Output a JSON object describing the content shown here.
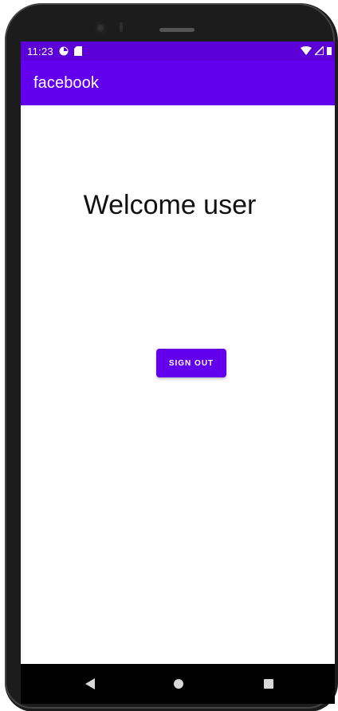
{
  "status_bar": {
    "time": "11:23",
    "icons": [
      "data-saver-icon",
      "sd-card-icon"
    ],
    "right_icons": [
      "wifi-icon",
      "signal-icon",
      "battery-icon"
    ]
  },
  "app_bar": {
    "title": "facebook"
  },
  "main": {
    "welcome_text": "Welcome user",
    "sign_out_label": "SIGN OUT"
  },
  "nav_bar": {
    "icons": [
      "back-icon",
      "home-icon",
      "recents-icon"
    ]
  },
  "colors": {
    "primary": "#6200ee",
    "status_bar": "#5c00d8",
    "background": "#ffffff"
  }
}
